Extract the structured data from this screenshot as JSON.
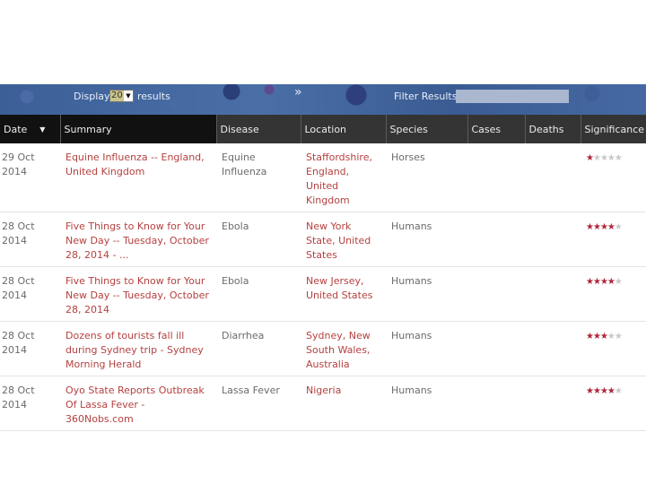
{
  "toolbar": {
    "display_prefix": "Display",
    "display_value": "20",
    "display_suffix": "results",
    "expand_icon": "double-chevron-down-icon",
    "filter_label": "Filter Results",
    "filter_value": ""
  },
  "table": {
    "columns": [
      "Date",
      "Summary",
      "Disease",
      "Location",
      "Species",
      "Cases",
      "Deaths",
      "Significance"
    ],
    "sort_column": "Date",
    "rows": [
      {
        "date": "29 Oct 2014",
        "summary": "Equine Influenza -- England, United Kingdom",
        "disease": "Equine Influenza",
        "location": "Staffordshire, England, United Kingdom",
        "species": "Horses",
        "cases": "",
        "deaths": "",
        "significance": 1
      },
      {
        "date": "28 Oct 2014",
        "summary": "Five Things to Know for Your New Day -- Tuesday, October 28, 2014 - ...",
        "disease": "Ebola",
        "location": "New York State, United States",
        "species": "Humans",
        "cases": "",
        "deaths": "",
        "significance": 4
      },
      {
        "date": "28 Oct 2014",
        "summary": "Five Things to Know for Your New Day -- Tuesday, October 28, 2014",
        "disease": "Ebola",
        "location": "New Jersey, United States",
        "species": "Humans",
        "cases": "",
        "deaths": "",
        "significance": 4
      },
      {
        "date": "28 Oct 2014",
        "summary": "Dozens of tourists fall ill during Sydney trip - Sydney Morning Herald",
        "disease": "Diarrhea",
        "location": "Sydney, New South Wales, Australia",
        "species": "Humans",
        "cases": "",
        "deaths": "",
        "significance": 3
      },
      {
        "date": "28 Oct 2014",
        "summary": "Oyo State Reports Outbreak Of Lassa Fever - 360Nobs.com",
        "disease": "Lassa Fever",
        "location": "Nigeria",
        "species": "Humans",
        "cases": "",
        "deaths": "",
        "significance": 4
      }
    ]
  }
}
